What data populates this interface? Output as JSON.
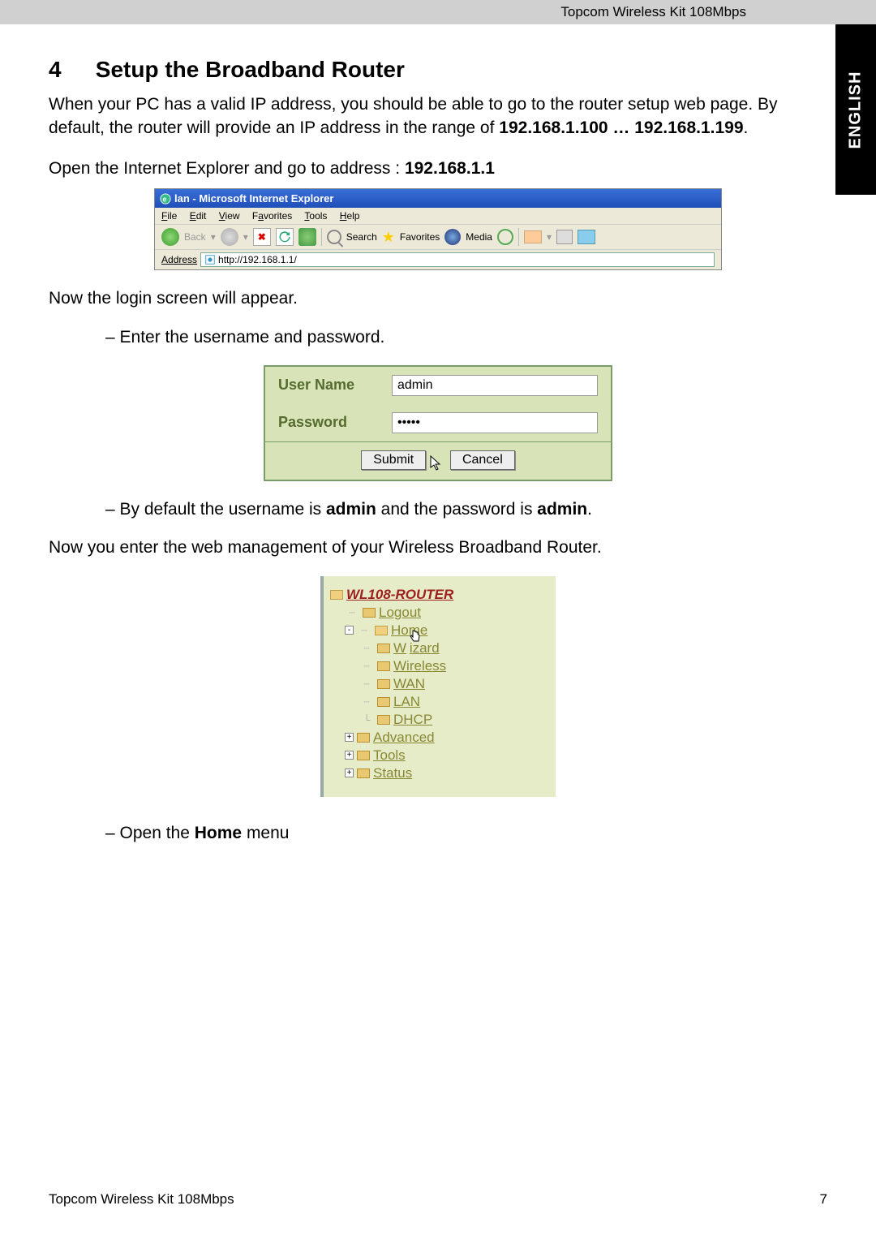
{
  "header": {
    "product": "Topcom Wireless Kit 108Mbps"
  },
  "sidetab": {
    "label": "ENGLISH"
  },
  "section": {
    "number": "4",
    "title": "Setup the Broadband Router"
  },
  "para1_a": "When your PC has a valid IP address, you should be able to go to the router setup web page. By default, the router will provide an IP address in the range of ",
  "para1_b": "192.168.1.100 … 192.168.1.199",
  "para1_c": ".",
  "para2_a": "Open the Internet Explorer and go to address : ",
  "para2_b": "192.168.1.1",
  "ie": {
    "title": "lan - Microsoft Internet Explorer",
    "menu": {
      "file": "File",
      "edit": "Edit",
      "view": "View",
      "favorites": "Favorites",
      "tools": "Tools",
      "help": "Help"
    },
    "toolbar": {
      "back": "Back",
      "search": "Search",
      "favorites": "Favorites",
      "media": "Media"
    },
    "address_label": "Address",
    "address_url": "http://192.168.1.1/"
  },
  "para3": "Now the login screen will appear.",
  "bullet1": "–    Enter the username and password.",
  "login": {
    "user_label": "User Name",
    "user_value": "admin",
    "pass_label": "Password",
    "pass_value": "•••••",
    "submit": "Submit",
    "cancel": "Cancel"
  },
  "bullet2_a": "–    By default the username is ",
  "bullet2_b": "admin",
  "bullet2_c": " and the password is ",
  "bullet2_d": "admin",
  "bullet2_e": ".",
  "para4": "Now you enter the web management of your Wireless Broadband Router.",
  "tree": {
    "root": "WL108-ROUTER",
    "logout": "Logout",
    "home": "Home",
    "wizard": "Wizard",
    "wireless": "Wireless",
    "wan": "WAN",
    "lan": "LAN",
    "dhcp": "DHCP",
    "advanced": "Advanced",
    "tools": "Tools",
    "status": "Status"
  },
  "bullet3_a": "–    Open the ",
  "bullet3_b": "Home",
  "bullet3_c": " menu",
  "footer": {
    "left": "Topcom Wireless Kit 108Mbps",
    "page": "7"
  }
}
